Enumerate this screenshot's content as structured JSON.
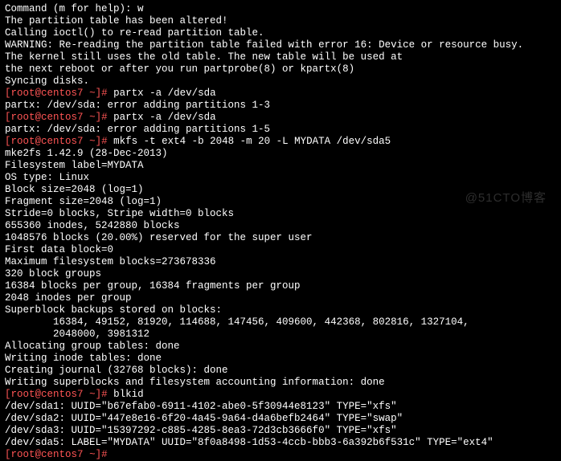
{
  "watermark": "@51CTO博客",
  "lines": {
    "l0": "Command (m for help): w",
    "l1": "The partition table has been altered!",
    "l2": "",
    "l3": "Calling ioctl() to re-read partition table.",
    "l4": "",
    "l5": "WARNING: Re-reading the partition table failed with error 16: Device or resource busy.",
    "l6": "The kernel still uses the old table. The new table will be used at",
    "l7": "the next reboot or after you run partprobe(8) or kpartx(8)",
    "l8": "Syncing disks.",
    "p1": {
      "user": "root",
      "host": "centos7",
      "path": "~",
      "cmd": "partx -a /dev/sda"
    },
    "l10": "partx: /dev/sda: error adding partitions 1-3",
    "p2": {
      "user": "root",
      "host": "centos7",
      "path": "~",
      "cmd": "partx -a /dev/sda"
    },
    "l12": "partx: /dev/sda: error adding partitions 1-5",
    "p3": {
      "user": "root",
      "host": "centos7",
      "path": "~",
      "cmd": "mkfs -t ext4 -b 2048 -m 20 -L MYDATA /dev/sda5"
    },
    "l14": "mke2fs 1.42.9 (28-Dec-2013)",
    "l15": "Filesystem label=MYDATA",
    "l16": "OS type: Linux",
    "l17": "Block size=2048 (log=1)",
    "l18": "Fragment size=2048 (log=1)",
    "l19": "Stride=0 blocks, Stripe width=0 blocks",
    "l20": "655360 inodes, 5242880 blocks",
    "l21": "1048576 blocks (20.00%) reserved for the super user",
    "l22": "First data block=0",
    "l23": "Maximum filesystem blocks=273678336",
    "l24": "320 block groups",
    "l25": "16384 blocks per group, 16384 fragments per group",
    "l26": "2048 inodes per group",
    "l27": "Superblock backups stored on blocks:",
    "l28": "        16384, 49152, 81920, 114688, 147456, 409600, 442368, 802816, 1327104,",
    "l29": "        2048000, 3981312",
    "l30": "",
    "l31": "Allocating group tables: done",
    "l32": "Writing inode tables: done",
    "l33": "Creating journal (32768 blocks): done",
    "l34": "Writing superblocks and filesystem accounting information: done",
    "l35": "",
    "p4": {
      "user": "root",
      "host": "centos7",
      "path": "~",
      "cmd": "blkid"
    },
    "l37": "/dev/sda1: UUID=\"b67efab0-6911-4102-abe0-5f30944e8123\" TYPE=\"xfs\"",
    "l38": "/dev/sda2: UUID=\"447e8e16-6f20-4a45-9a64-d4a6befb2464\" TYPE=\"swap\"",
    "l39": "/dev/sda3: UUID=\"15397292-c885-4285-8ea3-72d3cb3666f0\" TYPE=\"xfs\"",
    "l40": "/dev/sda5: LABEL=\"MYDATA\" UUID=\"8f0a8498-1d53-4ccb-bbb3-6a392b6f531c\" TYPE=\"ext4\"",
    "p5": {
      "user": "root",
      "host": "centos7",
      "path": "~",
      "cmd": ""
    }
  }
}
